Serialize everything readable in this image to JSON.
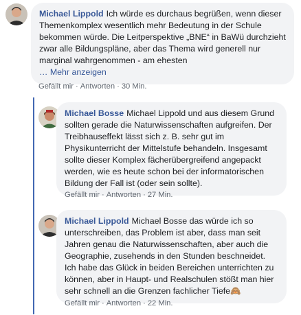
{
  "comments": [
    {
      "author": "Michael Lippold",
      "text": "Ich würde es durchaus begrüßen, wenn dieser Themenkomplex wesentlich mehr Bedeutung in der Schule bekommen würde. Die Leitperspektive „BNE“ in BaWü durchzieht zwar alle Bildungspläne, aber das Thema wird generell nur marginal wahrgenommen - am ehesten",
      "more": "… Mehr anzeigen",
      "like": "Gefällt mir",
      "reply": "Antworten",
      "time": "30 Min."
    },
    {
      "author": "Michael Bosse",
      "text": "Michael Lippold und aus diesem Grund sollten gerade die Naturwissenschaften aufgreifen. Der Treibhauseffekt lässt sich z. B. sehr gut im Physikunterricht der Mittelstufe behandeln. Insgesamt sollte dieser Komplex fächerübergreifend angepackt werden, wie es heute schon bei der informatorischen Bildung der Fall ist (oder sein sollte).",
      "like": "Gefällt mir",
      "reply": "Antworten",
      "time": "27 Min."
    },
    {
      "author": "Michael Lippold",
      "text": "Michael Bosse das würde ich so unterschreiben, das Problem ist aber, dass man seit Jahren genau die Naturwissenschaften, aber auch die Geographie, zusehends in den Stunden beschneidet. Ich habe das Glück in beiden Bereichen unterrichten zu können, aber in Haupt- und Realschulen stößt man hier sehr schnell an die Grenzen fachlicher Tiefe",
      "emoji": "🙈",
      "like": "Gefällt mir",
      "reply": "Antworten",
      "time": "22 Min."
    }
  ],
  "separator": "·"
}
